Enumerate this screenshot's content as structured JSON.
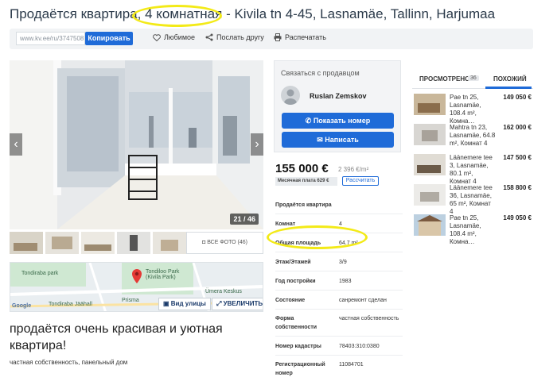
{
  "title": {
    "part1": "Продаётся квартира,",
    "part2": "4 комнатная",
    "part3": "- Kivila tn 4-45, Lasnamäe, Tallinn, Harjumaa"
  },
  "toolbar": {
    "url": "www.kv.ee/ru/3747508",
    "copy_label": "Копировать",
    "favorite_label": "Любимое",
    "send_label": "Послать другу",
    "print_label": "Распечатать"
  },
  "gallery": {
    "counter": "21 / 46",
    "more_photos_label": "ВСЕ ФОТО",
    "more_photos_count": "(46)",
    "prev_icon": "chevron-left-icon",
    "next_icon": "chevron-right-icon"
  },
  "map": {
    "street_view_label": "Вид улицы",
    "zoom_label": "УВЕЛИЧИТЬ",
    "labels": [
      "Tondiraba park",
      "Tondiloo Park (Kivila Park)",
      "Prisma",
      "Ümera Keskus",
      "Tondiraba Jäähall",
      "Google"
    ]
  },
  "description": {
    "heading": "продаётся очень красивая и уютная квартира!",
    "subtitle": "частная собственность, панельный дом"
  },
  "contact": {
    "title": "Связаться с продавцом",
    "seller_name": "Ruslan Zemskov",
    "show_number_label": "Показать номер",
    "write_label": "Написать"
  },
  "price": {
    "amount": "155 000 €",
    "per_m2": "2 396 €/m²",
    "monthly_label": "Месячная плата 629 €",
    "calc_label": "Рассчитать"
  },
  "details": [
    {
      "key": "Продаётся квартира",
      "value": ""
    },
    {
      "key": "Комнат",
      "value": "4"
    },
    {
      "key": "Общая площадь",
      "value": "64.7 m²"
    },
    {
      "key": "Этаж/Этажей",
      "value": "3/9"
    },
    {
      "key": "Год постройки",
      "value": "1983"
    },
    {
      "key": "Состояние",
      "value": "санремонт сделан"
    },
    {
      "key": "Форма собственности",
      "value": "частная собственность"
    },
    {
      "key": "Номер кадастры",
      "value": "78403:310:0380"
    },
    {
      "key": "Регистрационный номер",
      "value": "11084701"
    }
  ],
  "sidebar": {
    "tab_viewed": "ПРОСМОТРЕНО",
    "tab_viewed_count": "36",
    "tab_similar": "ПОХОЖИЙ",
    "listings": [
      {
        "text": "Pae tn 25, Lasnamäe, 108.4 m², Комна…",
        "price": "149 050 €"
      },
      {
        "text": "Mahtra tn 23, Lasnamäe, 64.8 m², Комнат 4",
        "price": "162 000 €"
      },
      {
        "text": "Läänemere tee 3, Lasnamäe, 80.1 m², Комнат 4",
        "price": "147 500 €"
      },
      {
        "text": "Läänemere tee 36, Lasnamäe, 65 m², Комнат 4",
        "price": "158 800 €"
      },
      {
        "text": "Pae tn 25, Lasnamäe, 108.4 m², Комна…",
        "price": "149 050 €"
      }
    ]
  },
  "colors": {
    "accent": "#1f6bd8",
    "highlight": "#f3ea17"
  }
}
